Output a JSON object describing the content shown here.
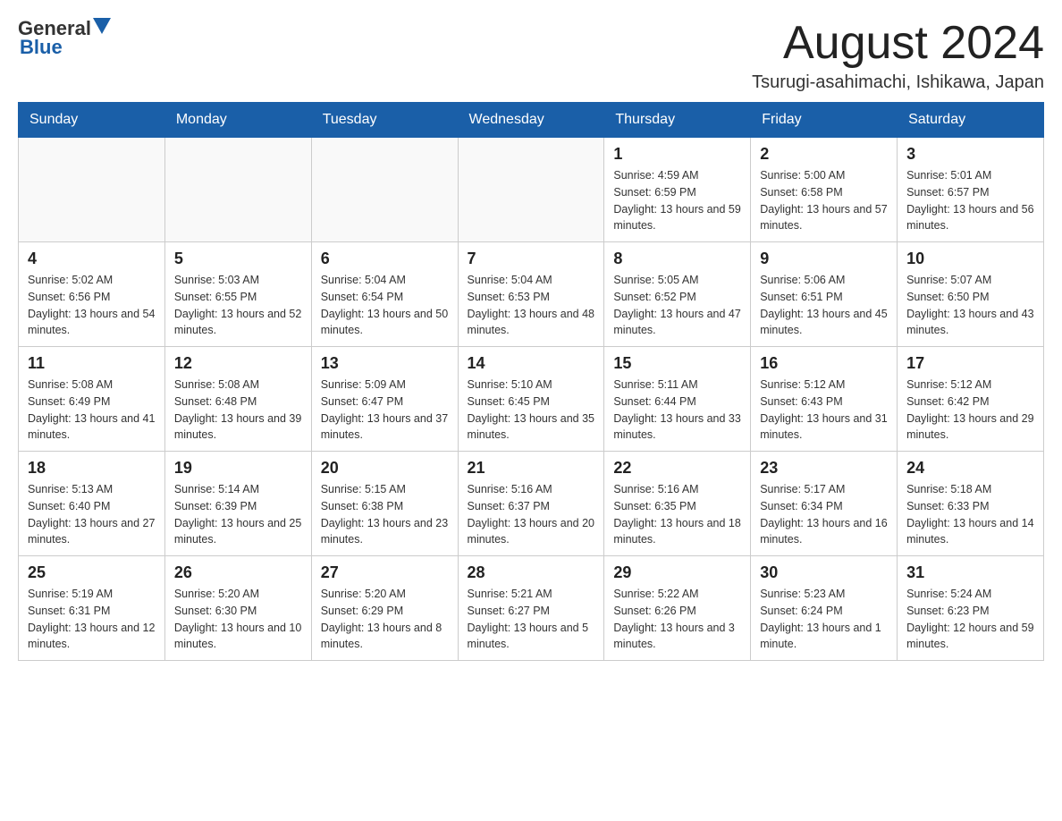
{
  "header": {
    "logo_general": "General",
    "logo_blue": "Blue",
    "month_title": "August 2024",
    "location": "Tsurugi-asahimachi, Ishikawa, Japan"
  },
  "days_of_week": [
    "Sunday",
    "Monday",
    "Tuesday",
    "Wednesday",
    "Thursday",
    "Friday",
    "Saturday"
  ],
  "weeks": [
    [
      {
        "day": "",
        "info": ""
      },
      {
        "day": "",
        "info": ""
      },
      {
        "day": "",
        "info": ""
      },
      {
        "day": "",
        "info": ""
      },
      {
        "day": "1",
        "info": "Sunrise: 4:59 AM\nSunset: 6:59 PM\nDaylight: 13 hours and 59 minutes."
      },
      {
        "day": "2",
        "info": "Sunrise: 5:00 AM\nSunset: 6:58 PM\nDaylight: 13 hours and 57 minutes."
      },
      {
        "day": "3",
        "info": "Sunrise: 5:01 AM\nSunset: 6:57 PM\nDaylight: 13 hours and 56 minutes."
      }
    ],
    [
      {
        "day": "4",
        "info": "Sunrise: 5:02 AM\nSunset: 6:56 PM\nDaylight: 13 hours and 54 minutes."
      },
      {
        "day": "5",
        "info": "Sunrise: 5:03 AM\nSunset: 6:55 PM\nDaylight: 13 hours and 52 minutes."
      },
      {
        "day": "6",
        "info": "Sunrise: 5:04 AM\nSunset: 6:54 PM\nDaylight: 13 hours and 50 minutes."
      },
      {
        "day": "7",
        "info": "Sunrise: 5:04 AM\nSunset: 6:53 PM\nDaylight: 13 hours and 48 minutes."
      },
      {
        "day": "8",
        "info": "Sunrise: 5:05 AM\nSunset: 6:52 PM\nDaylight: 13 hours and 47 minutes."
      },
      {
        "day": "9",
        "info": "Sunrise: 5:06 AM\nSunset: 6:51 PM\nDaylight: 13 hours and 45 minutes."
      },
      {
        "day": "10",
        "info": "Sunrise: 5:07 AM\nSunset: 6:50 PM\nDaylight: 13 hours and 43 minutes."
      }
    ],
    [
      {
        "day": "11",
        "info": "Sunrise: 5:08 AM\nSunset: 6:49 PM\nDaylight: 13 hours and 41 minutes."
      },
      {
        "day": "12",
        "info": "Sunrise: 5:08 AM\nSunset: 6:48 PM\nDaylight: 13 hours and 39 minutes."
      },
      {
        "day": "13",
        "info": "Sunrise: 5:09 AM\nSunset: 6:47 PM\nDaylight: 13 hours and 37 minutes."
      },
      {
        "day": "14",
        "info": "Sunrise: 5:10 AM\nSunset: 6:45 PM\nDaylight: 13 hours and 35 minutes."
      },
      {
        "day": "15",
        "info": "Sunrise: 5:11 AM\nSunset: 6:44 PM\nDaylight: 13 hours and 33 minutes."
      },
      {
        "day": "16",
        "info": "Sunrise: 5:12 AM\nSunset: 6:43 PM\nDaylight: 13 hours and 31 minutes."
      },
      {
        "day": "17",
        "info": "Sunrise: 5:12 AM\nSunset: 6:42 PM\nDaylight: 13 hours and 29 minutes."
      }
    ],
    [
      {
        "day": "18",
        "info": "Sunrise: 5:13 AM\nSunset: 6:40 PM\nDaylight: 13 hours and 27 minutes."
      },
      {
        "day": "19",
        "info": "Sunrise: 5:14 AM\nSunset: 6:39 PM\nDaylight: 13 hours and 25 minutes."
      },
      {
        "day": "20",
        "info": "Sunrise: 5:15 AM\nSunset: 6:38 PM\nDaylight: 13 hours and 23 minutes."
      },
      {
        "day": "21",
        "info": "Sunrise: 5:16 AM\nSunset: 6:37 PM\nDaylight: 13 hours and 20 minutes."
      },
      {
        "day": "22",
        "info": "Sunrise: 5:16 AM\nSunset: 6:35 PM\nDaylight: 13 hours and 18 minutes."
      },
      {
        "day": "23",
        "info": "Sunrise: 5:17 AM\nSunset: 6:34 PM\nDaylight: 13 hours and 16 minutes."
      },
      {
        "day": "24",
        "info": "Sunrise: 5:18 AM\nSunset: 6:33 PM\nDaylight: 13 hours and 14 minutes."
      }
    ],
    [
      {
        "day": "25",
        "info": "Sunrise: 5:19 AM\nSunset: 6:31 PM\nDaylight: 13 hours and 12 minutes."
      },
      {
        "day": "26",
        "info": "Sunrise: 5:20 AM\nSunset: 6:30 PM\nDaylight: 13 hours and 10 minutes."
      },
      {
        "day": "27",
        "info": "Sunrise: 5:20 AM\nSunset: 6:29 PM\nDaylight: 13 hours and 8 minutes."
      },
      {
        "day": "28",
        "info": "Sunrise: 5:21 AM\nSunset: 6:27 PM\nDaylight: 13 hours and 5 minutes."
      },
      {
        "day": "29",
        "info": "Sunrise: 5:22 AM\nSunset: 6:26 PM\nDaylight: 13 hours and 3 minutes."
      },
      {
        "day": "30",
        "info": "Sunrise: 5:23 AM\nSunset: 6:24 PM\nDaylight: 13 hours and 1 minute."
      },
      {
        "day": "31",
        "info": "Sunrise: 5:24 AM\nSunset: 6:23 PM\nDaylight: 12 hours and 59 minutes."
      }
    ]
  ]
}
